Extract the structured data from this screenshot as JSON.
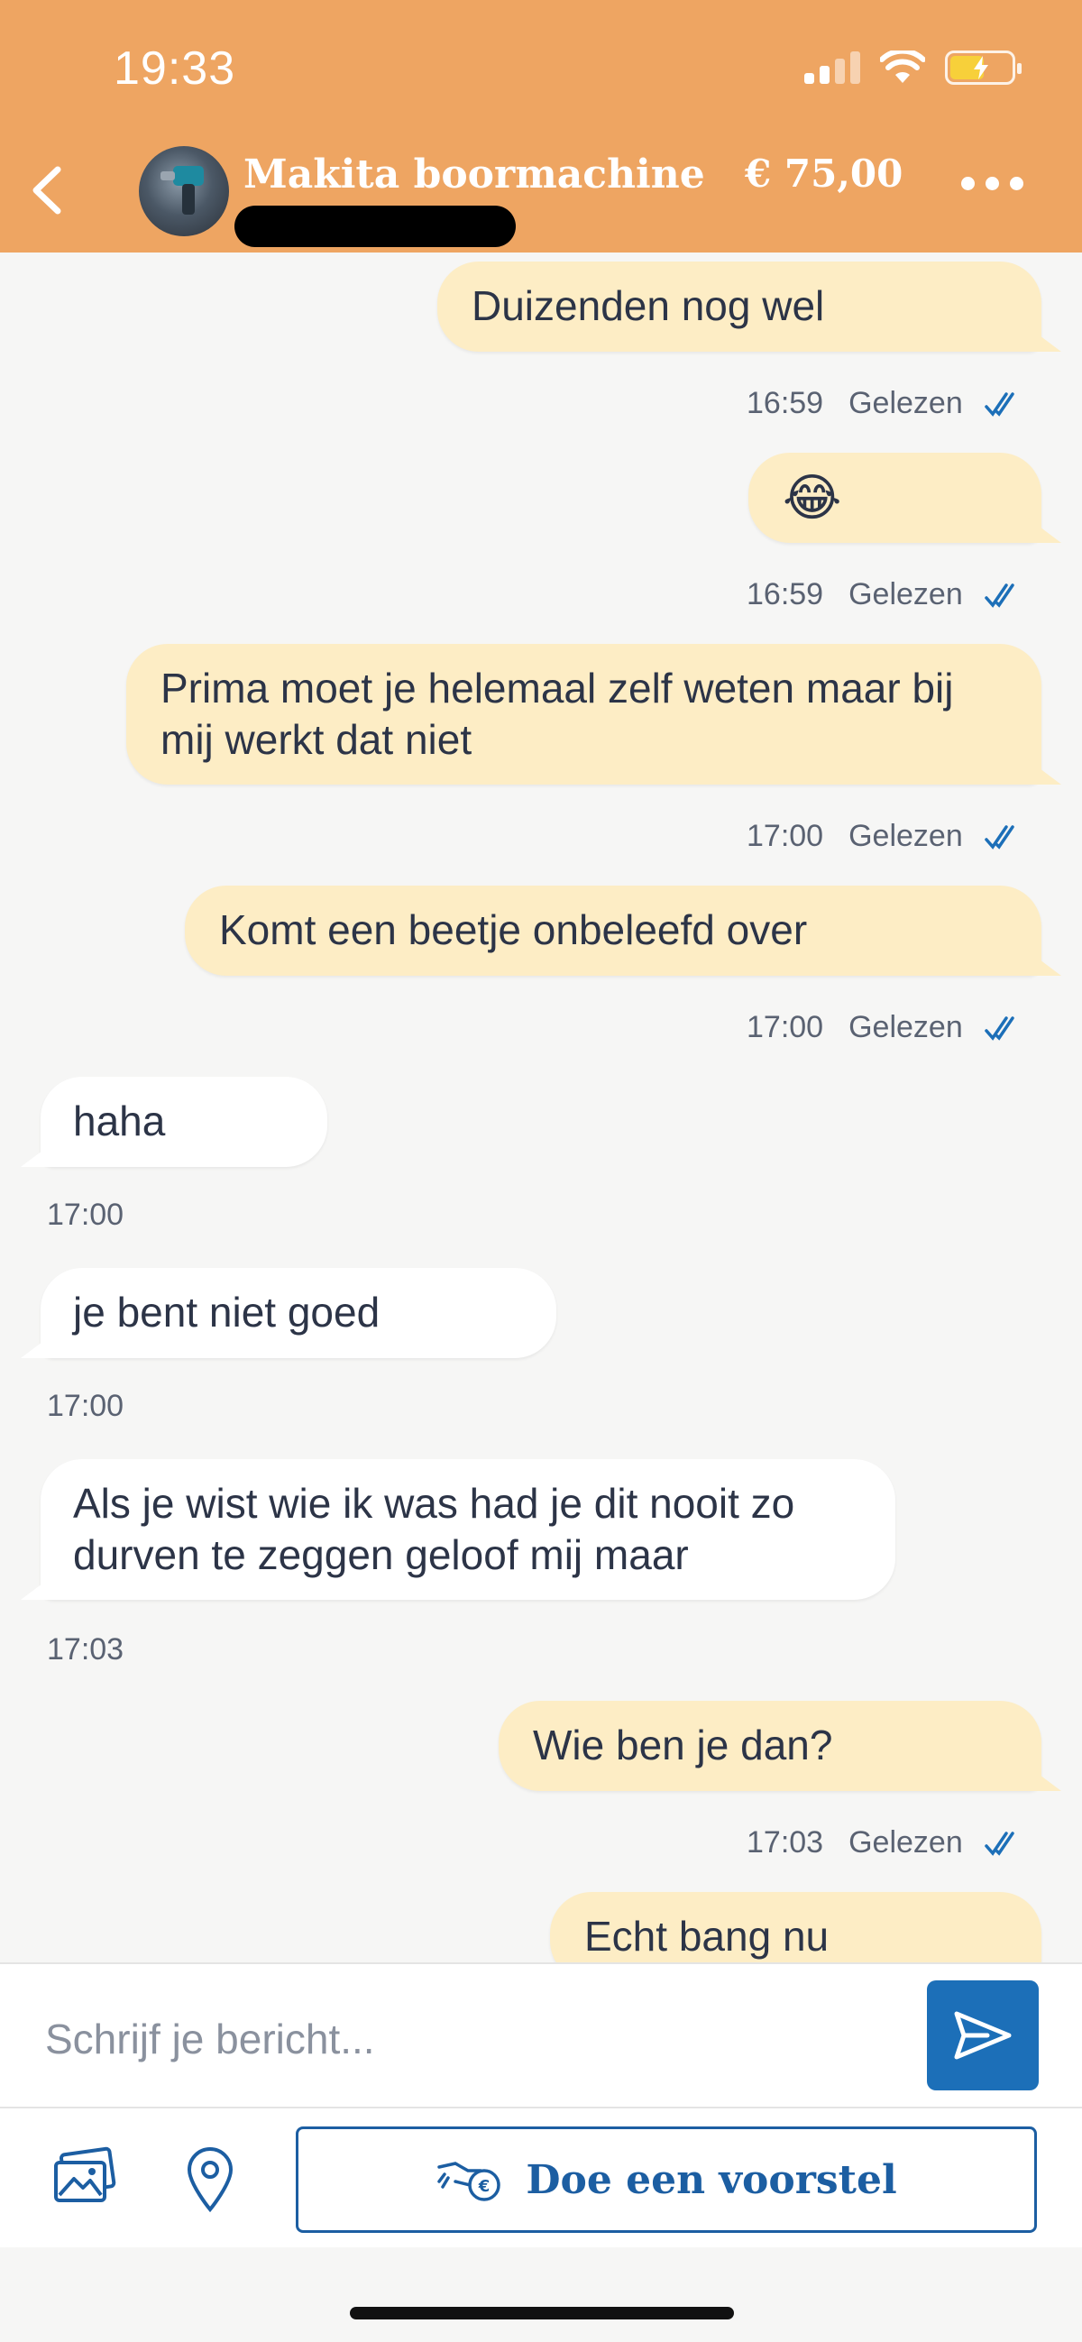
{
  "status_bar": {
    "time": "19:33"
  },
  "header": {
    "title": "Makita boormachine",
    "price": "€ 75,00"
  },
  "messages": [
    {
      "text": "Duizenden nog wel",
      "time": "16:59",
      "status": "Gelezen"
    },
    {
      "text": "😂",
      "time": "16:59",
      "status": "Gelezen"
    },
    {
      "text": "Prima moet je helemaal zelf weten maar bij mij werkt dat niet",
      "time": "17:00",
      "status": "Gelezen"
    },
    {
      "text": "Komt een beetje onbeleefd over",
      "time": "17:00",
      "status": "Gelezen"
    },
    {
      "text": "haha",
      "time": "17:00"
    },
    {
      "text": "je bent niet goed",
      "time": "17:00"
    },
    {
      "text": "Als je wist wie ik was had je dit nooit zo durven te zeggen geloof mij maar",
      "time": "17:03"
    },
    {
      "text": "Wie ben je dan?",
      "time": "17:03",
      "status": "Gelezen"
    },
    {
      "text": "Echt bang nu"
    }
  ],
  "composer": {
    "placeholder": "Schrijf je bericht..."
  },
  "toolbar": {
    "offer_label": "Doe een voorstel"
  },
  "colors": {
    "header": "#eea562",
    "outgoing_bubble": "#fdedc5",
    "incoming_bubble": "#ffffff",
    "accent": "#1c6fb8"
  }
}
